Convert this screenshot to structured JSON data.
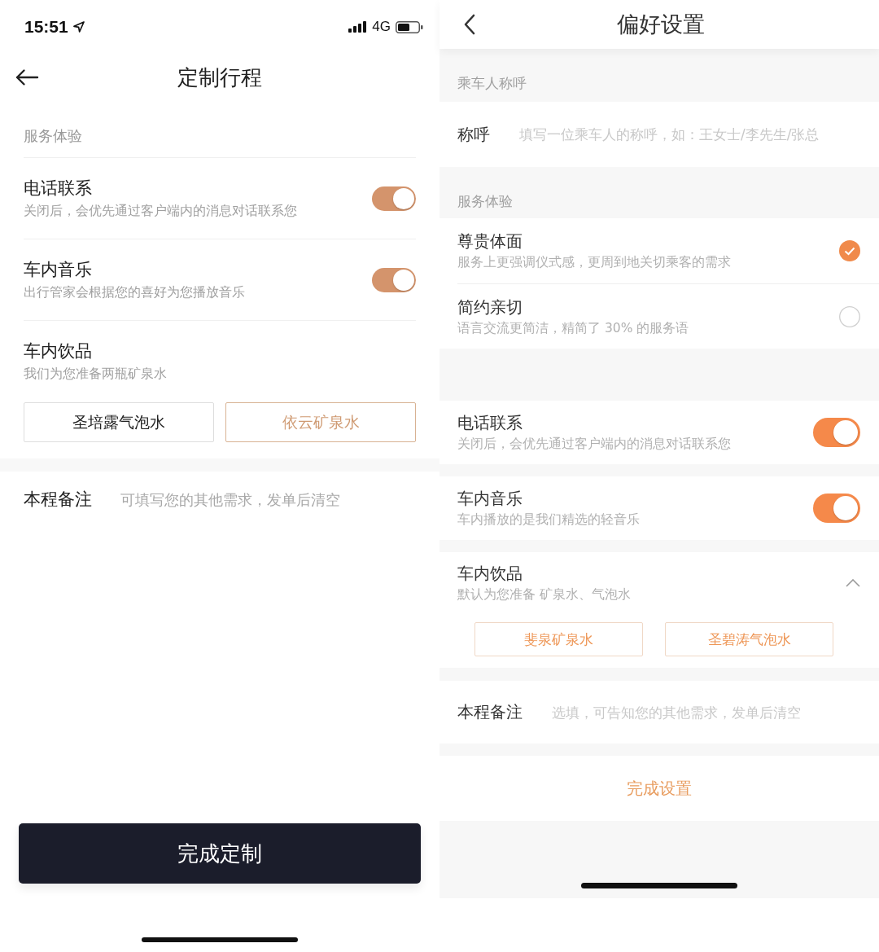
{
  "trip_screen": {
    "status_bar": {
      "time": "15:51",
      "network": "4G"
    },
    "nav": {
      "title": "定制行程"
    },
    "section_header": "服务体验",
    "options": [
      {
        "kind": "toggle",
        "title": "电话联系",
        "subtitle": "关闭后，会优先通过客户端内的消息对话联系您",
        "on": true
      },
      {
        "kind": "toggle",
        "title": "车内音乐",
        "subtitle": "出行管家会根据您的喜好为您播放音乐",
        "on": true
      },
      {
        "kind": "choice",
        "title": "车内饮品",
        "subtitle": "我们为您准备两瓶矿泉水",
        "choices": [
          {
            "label": "圣培露气泡水",
            "selected": false
          },
          {
            "label": "依云矿泉水",
            "selected": true
          }
        ]
      }
    ],
    "note": {
      "label": "本程备注",
      "placeholder": "可填写您的其他需求，发单后清空"
    },
    "submit_button": "完成定制"
  },
  "preferences_screen": {
    "nav": {
      "title": "偏好设置"
    },
    "name_section": {
      "header": "乘车人称呼",
      "label": "称呼",
      "placeholder": "填写一位乘车人的称呼，如：王女士/李先生/张总"
    },
    "service_section": {
      "header": "服务体验",
      "styles": [
        {
          "title": "尊贵体面",
          "subtitle": "服务上更强调仪式感，更周到地关切乘客的需求",
          "selected": true
        },
        {
          "title": "简约亲切",
          "subtitle": "语言交流更简洁，精简了 30% 的服务语",
          "selected": false
        }
      ]
    },
    "options": [
      {
        "kind": "toggle",
        "title": "电话联系",
        "subtitle": "关闭后，会优先通过客户端内的消息对话联系您",
        "on": true
      },
      {
        "kind": "toggle",
        "title": "车内音乐",
        "subtitle": "车内播放的是我们精选的轻音乐",
        "on": true
      },
      {
        "kind": "choice",
        "title": "车内饮品",
        "subtitle": "默认为您准备 矿泉水、气泡水",
        "expanded": true,
        "choices": [
          {
            "label": "斐泉矿泉水",
            "selected": true
          },
          {
            "label": "圣碧涛气泡水",
            "selected": true
          }
        ]
      }
    ],
    "note": {
      "label": "本程备注",
      "placeholder": "选填，可告知您的其他需求，发单后清空"
    },
    "finish_button": "完成设置"
  }
}
